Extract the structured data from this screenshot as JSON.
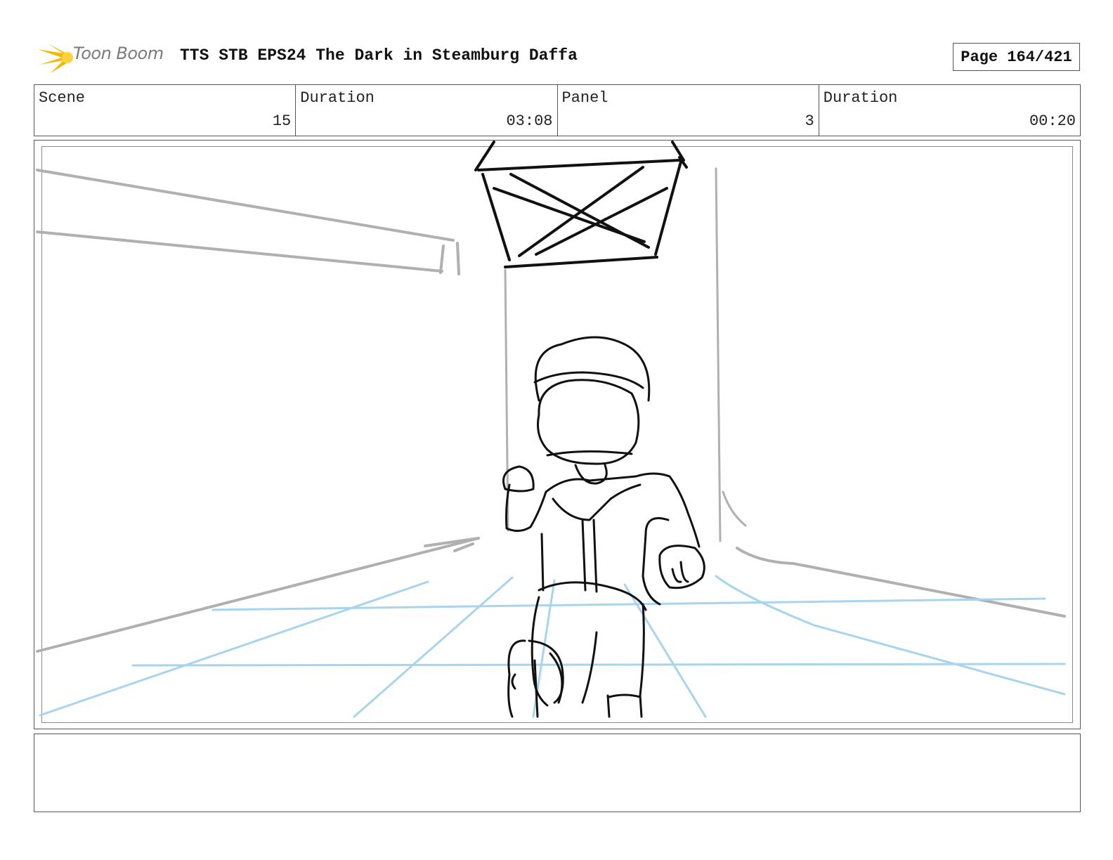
{
  "header": {
    "logo_text": "Toon Boom",
    "title": "TTS STB EPS24 The Dark in Steamburg Daffa",
    "page_label": "Page 164/421"
  },
  "info": {
    "scene_label": "Scene",
    "scene_value": "15",
    "scene_duration_label": "Duration",
    "scene_duration_value": "03:08",
    "panel_label": "Panel",
    "panel_value": "3",
    "panel_duration_label": "Duration",
    "panel_duration_value": "00:20"
  },
  "notes": {
    "text": ""
  },
  "colors": {
    "logo_accent": "#f5b800",
    "perspective_guides": "#a8d4ee",
    "background_lines": "#b0b0b0",
    "ink": "#111111"
  }
}
